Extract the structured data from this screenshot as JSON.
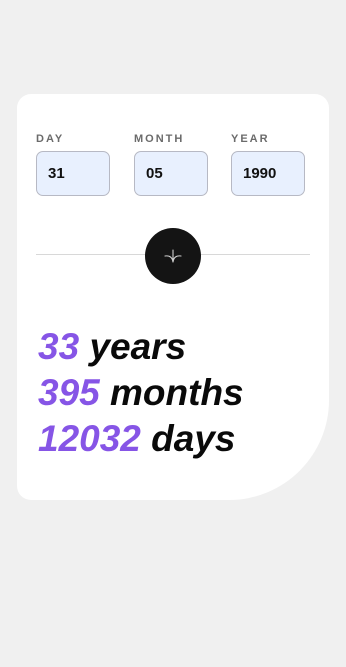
{
  "inputs": {
    "day": {
      "label": "DAY",
      "value": "31"
    },
    "month": {
      "label": "MONTH",
      "value": "05"
    },
    "year": {
      "label": "YEAR",
      "value": "1990"
    }
  },
  "submit": {
    "icon": "arrow-down-icon"
  },
  "results": {
    "years": {
      "value": "33",
      "unit": "years"
    },
    "months": {
      "value": "395",
      "unit": "months"
    },
    "days": {
      "value": "12032",
      "unit": "days"
    }
  },
  "colors": {
    "accent": "#8655e6",
    "page_background": "#f0f0f0",
    "card_background": "#ffffff",
    "button_background": "#141414",
    "input_background": "#e8f0fe"
  }
}
